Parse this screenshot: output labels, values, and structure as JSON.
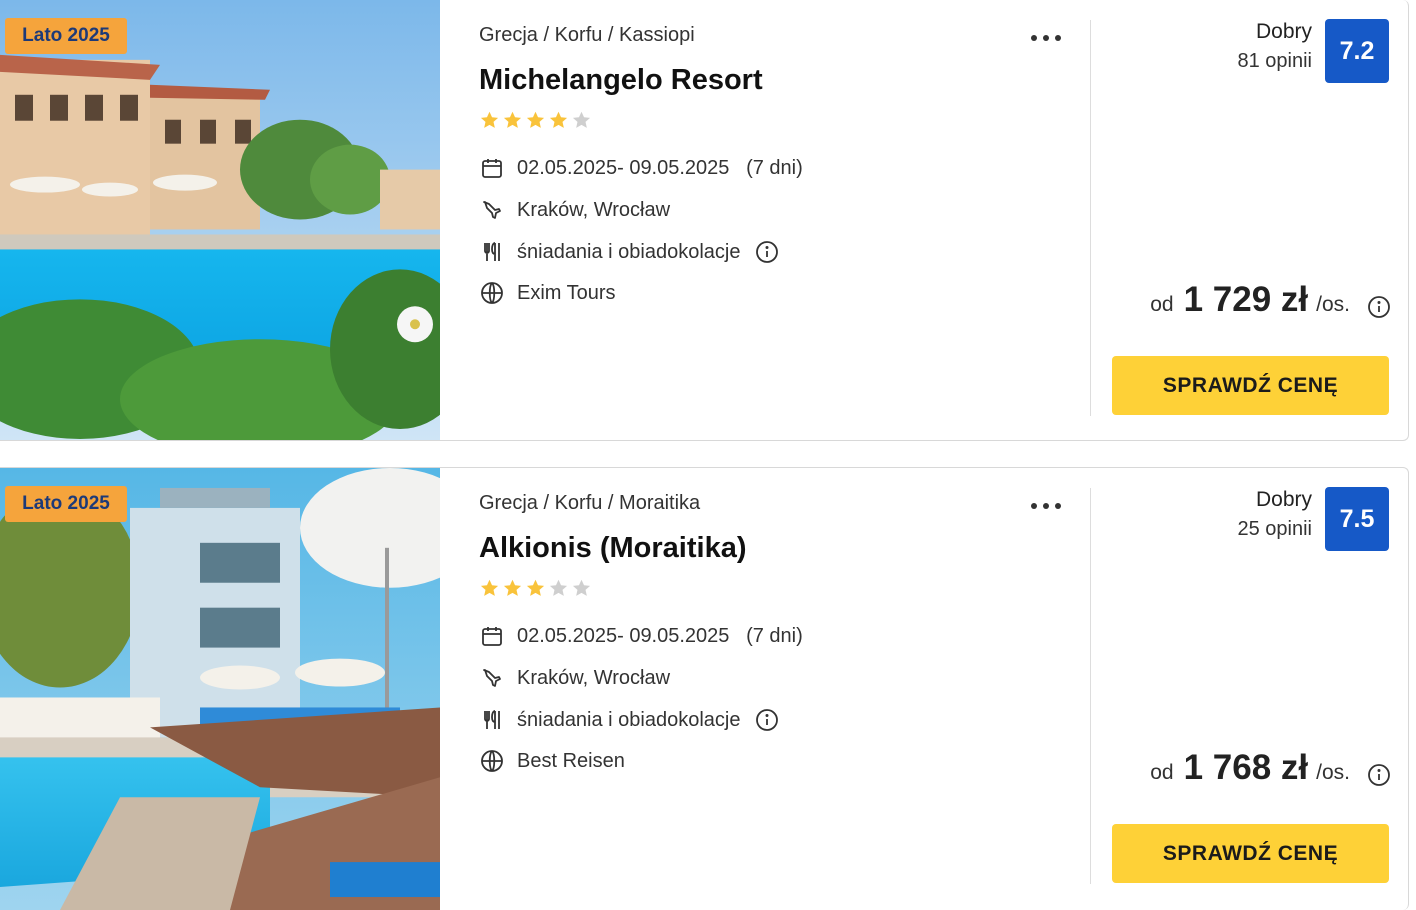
{
  "offers": [
    {
      "badge": "Lato 2025",
      "breadcrumb": "Grecja / Korfu / Kassiopi",
      "title": "Michelangelo Resort",
      "stars": 4,
      "dates": "02.05.2025- 09.05.2025",
      "duration": "(7 dni)",
      "departure": "Kraków, Wrocław",
      "board": "śniadania i obiadokolacje",
      "operator": "Exim Tours",
      "rating_word": "Dobry",
      "rating_count": "81 opinii",
      "rating_score": "7.2",
      "price_prefix": "od",
      "price": "1 729 zł",
      "price_suffix": "/os.",
      "cta_label": "SPRAWDŹ CENĘ"
    },
    {
      "badge": "Lato 2025",
      "breadcrumb": "Grecja / Korfu / Moraitika",
      "title": "Alkionis (Moraitika)",
      "stars": 3,
      "dates": "02.05.2025- 09.05.2025",
      "duration": "(7 dni)",
      "departure": "Kraków, Wrocław",
      "board": "śniadania i obiadokolacje",
      "operator": "Best Reisen",
      "rating_word": "Dobry",
      "rating_count": "25 opinii",
      "rating_score": "7.5",
      "price_prefix": "od",
      "price": "1 768 zł",
      "price_suffix": "/os.",
      "cta_label": "SPRAWDŹ CENĘ"
    }
  ],
  "colors": {
    "badge_bg": "#f5a43c",
    "badge_text": "#1d3a78",
    "rating_bg": "#1659c7",
    "cta_bg": "#fed137",
    "star_on": "#f9c33b",
    "star_off": "#cfcfcf"
  },
  "icons": [
    "heart-icon",
    "calendar-icon",
    "plane-icon",
    "cutlery-icon",
    "info-icon",
    "globe-icon",
    "more-icon",
    "star-icon"
  ]
}
